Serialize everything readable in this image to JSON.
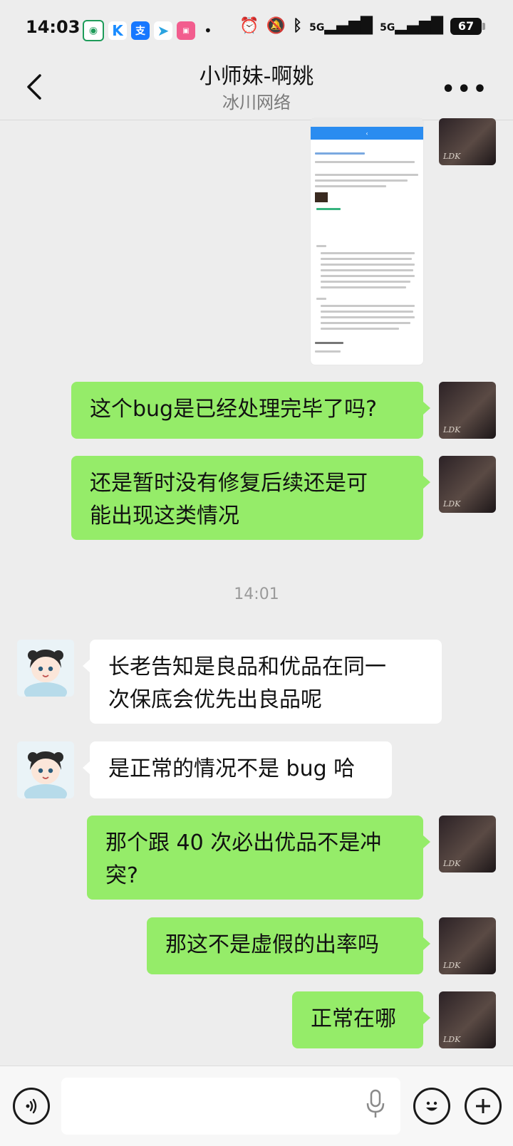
{
  "status_bar": {
    "time": "14:03",
    "network_1": "5G",
    "network_2": "5G",
    "battery": "67"
  },
  "header": {
    "title": "小师妹-啊姚",
    "subtitle": "冰川网络"
  },
  "timestamp": "14:01",
  "messages": [
    {
      "side": "me",
      "text": "这个bug是已经处理完毕了吗?"
    },
    {
      "side": "me",
      "text": "还是暂时没有修复后续还是可\n能出现这类情况"
    },
    {
      "side": "them",
      "text": "长老告知是良品和优品在同一\n次保底会优先出良品呢"
    },
    {
      "side": "them",
      "text": "是正常的情况不是 bug 哈"
    },
    {
      "side": "me",
      "text": "那个跟 40 次必出优品不是冲\n突?"
    },
    {
      "side": "me",
      "text": "那这不是虚假的出率吗"
    },
    {
      "side": "me",
      "text": "正常在哪"
    }
  ],
  "avatar_watermark": "LDK",
  "colors": {
    "my_bubble": "#95ec69",
    "their_bubble": "#ffffff",
    "background": "#ededed"
  }
}
